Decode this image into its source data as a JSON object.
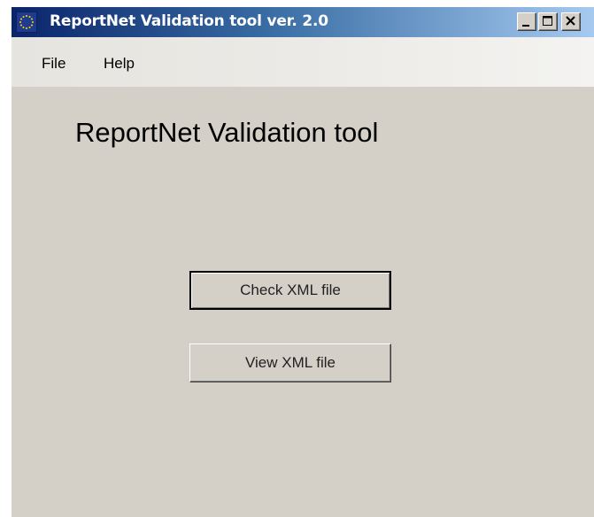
{
  "window": {
    "title": "ReportNet Validation tool ver. 2.0",
    "icon": "eu-stars-icon",
    "controls": {
      "minimize": "minimize-icon",
      "maximize": "maximize-icon",
      "close": "close-icon"
    }
  },
  "menu": {
    "items": [
      {
        "label": "File"
      },
      {
        "label": "Help"
      }
    ]
  },
  "main": {
    "heading": "ReportNet Validation tool",
    "buttons": [
      {
        "label": "Check XML file",
        "default": true
      },
      {
        "label": "View XML file",
        "default": false
      }
    ]
  },
  "colors": {
    "window_background": "#d4d0c8",
    "titlebar_start": "#0a246a",
    "titlebar_end": "#a6caf0",
    "title_text": "#ffffff"
  }
}
